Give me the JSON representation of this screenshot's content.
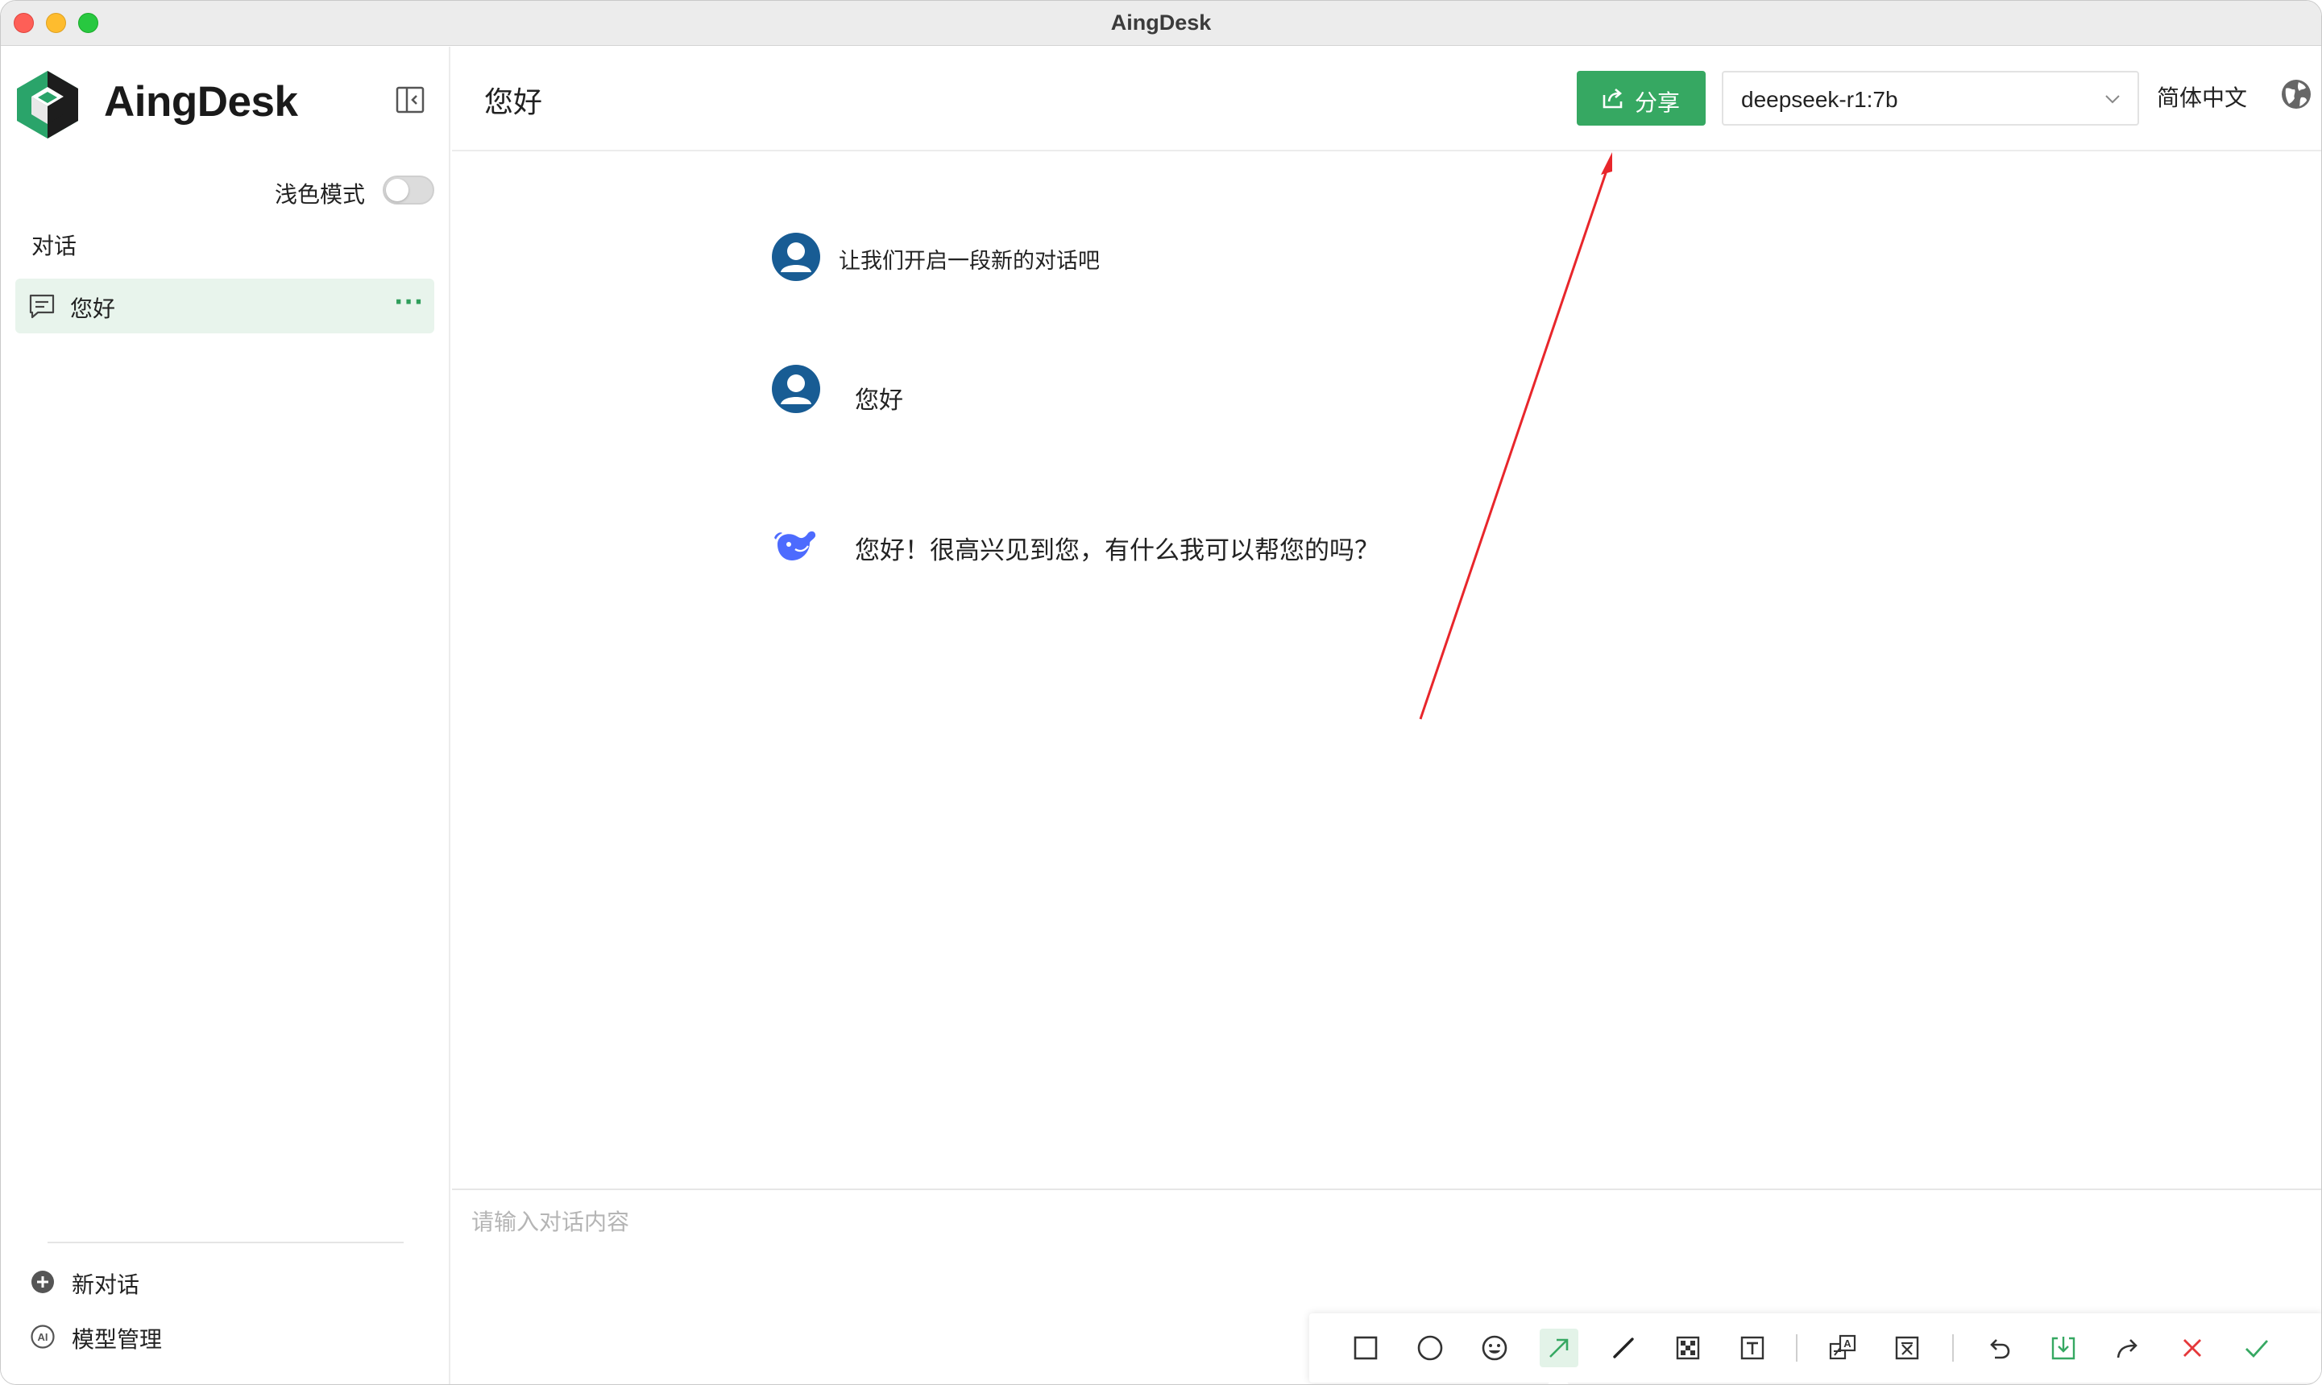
{
  "window": {
    "title": "AingDesk"
  },
  "sidebar": {
    "brand": "AingDesk",
    "theme_toggle_label": "浅色模式",
    "theme_toggle_on": false,
    "section_label": "对话",
    "conversations": [
      {
        "label": "您好",
        "more": "···",
        "active": true
      }
    ],
    "actions": [
      {
        "label": "新对话",
        "icon": "plus-circle-icon"
      },
      {
        "label": "模型管理",
        "icon": "ai-circle-icon"
      }
    ]
  },
  "header": {
    "title": "您好",
    "share_label": "分享",
    "model_selected": "deepseek-r1:7b",
    "language": "简体中文"
  },
  "chat": {
    "messages": [
      {
        "role": "user",
        "text": "让我们开启一段新的对话吧",
        "icon": "user-avatar-icon"
      },
      {
        "role": "user",
        "text": "您好",
        "icon": "user-avatar-icon"
      },
      {
        "role": "assistant",
        "text": "您好！很高兴见到您，有什么我可以帮您的吗？",
        "icon": "deepseek-whale-icon"
      }
    ]
  },
  "input": {
    "placeholder": "请输入对话内容"
  },
  "annotation": {
    "color": "#e8262b"
  },
  "toolbar": {
    "tools": [
      "rectangle-tool-icon",
      "ellipse-tool-icon",
      "emoji-tool-icon",
      "arrow-tool-icon",
      "pen-tool-icon",
      "mosaic-tool-icon",
      "text-tool-icon",
      "translate-tool-icon",
      "ocr-tool-icon",
      "undo-icon",
      "save-download-icon",
      "share-forward-icon",
      "cancel-icon",
      "confirm-icon"
    ],
    "active_tool": "arrow-tool-icon"
  },
  "colors": {
    "accent": "#36a862",
    "active_bg": "#e8f4ec",
    "avatar": "#185c94",
    "deepseek": "#4d6bfe"
  }
}
